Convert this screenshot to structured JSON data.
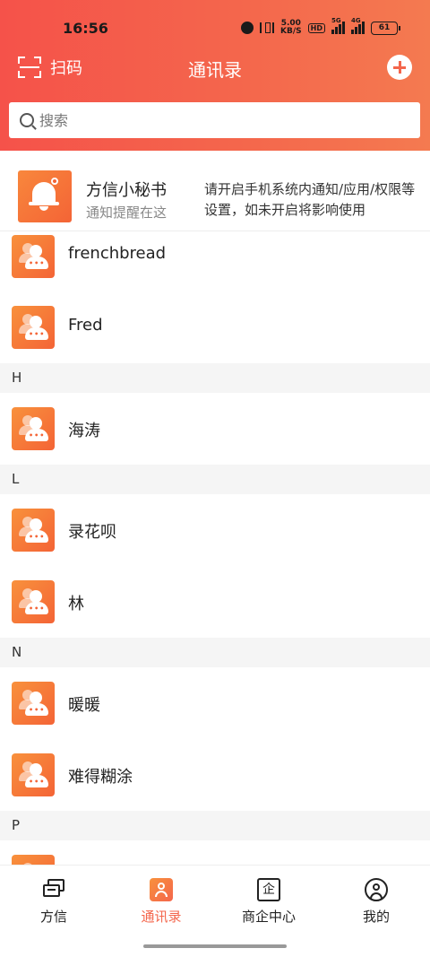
{
  "status_bar": {
    "time": "16:56",
    "net_speed_value": "5.00",
    "net_speed_unit": "KB/S",
    "hd_label": "HD",
    "signal_1_label": "5G",
    "signal_2_label": "4G",
    "battery": "61"
  },
  "header": {
    "scan_label": "扫码",
    "title": "通讯录",
    "accent_color": "#f4664c"
  },
  "search": {
    "placeholder": "搜索",
    "value": ""
  },
  "notice": {
    "title": "方信小秘书",
    "subtitle": "通知提醒在这",
    "message": "请开启手机系统内通知/应用/权限等设置，如未开启将影响使用"
  },
  "contacts": {
    "rows": [
      {
        "name": "frenchbread"
      },
      {
        "name": "Fred"
      },
      {
        "name": "海涛"
      },
      {
        "name": "录花呗"
      },
      {
        "name": "林"
      },
      {
        "name": "暖暖"
      },
      {
        "name": "难得糊涂"
      }
    ],
    "sections": [
      "H",
      "L",
      "N",
      "P"
    ]
  },
  "tabbar": {
    "tabs": [
      {
        "label": "方信",
        "icon": "chat-icon"
      },
      {
        "label": "通讯录",
        "icon": "contacts-icon",
        "active": true
      },
      {
        "label": "商企中心",
        "icon": "business-icon",
        "glyph": "企"
      },
      {
        "label": "我的",
        "icon": "profile-icon"
      }
    ]
  }
}
